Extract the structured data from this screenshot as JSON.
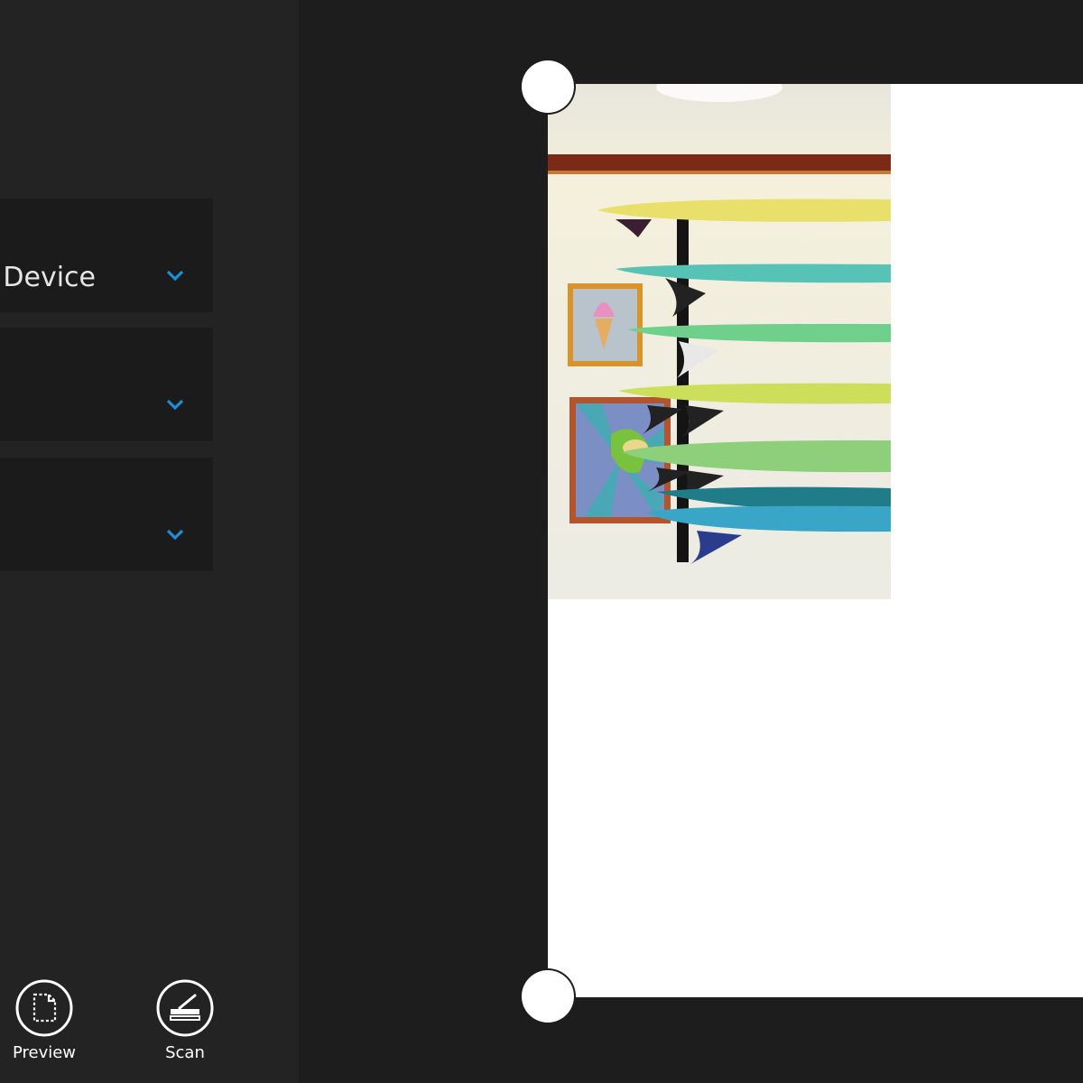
{
  "sidebar": {
    "dropdowns": [
      {
        "name": "source",
        "value": "r Device"
      },
      {
        "name": "option-2",
        "value": ""
      },
      {
        "name": "option-3",
        "value": ""
      }
    ],
    "actions": {
      "preview_label": "Preview",
      "scan_label": "Scan"
    }
  },
  "colors": {
    "background": "#1d1d1d",
    "sidebar": "#232323",
    "dropdown": "#1b1b1b",
    "accent": "#1a8fd6",
    "page": "#ffffff"
  },
  "icons": {
    "dropdown": "chevron-down-icon",
    "preview": "preview-page-icon",
    "scan": "scanner-icon",
    "crop": "crop-handle"
  }
}
